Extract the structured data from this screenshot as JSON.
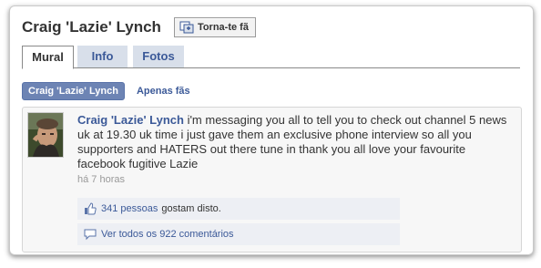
{
  "header": {
    "title": "Craig 'Lazie' Lynch",
    "fan_button": "Torna-te fã"
  },
  "tabs": [
    {
      "label": "Mural",
      "active": true
    },
    {
      "label": "Info",
      "active": false
    },
    {
      "label": "Fotos",
      "active": false
    }
  ],
  "filters": {
    "selected": "Craig 'Lazie' Lynch",
    "other": "Apenas fãs"
  },
  "post": {
    "author": "Craig 'Lazie' Lynch",
    "text": " i'm messaging you all to tell you to check out channel 5 news uk at 19.30 uk time i just gave them an exclusive phone interview so all you supporters and HATERS out there tune in thank you all love your favourite facebook fugitive Lazie",
    "time": "há 7 horas",
    "likes_link": "341 pessoas",
    "likes_suffix": "gostam disto.",
    "comments_link": "Ver todos os 922 comentários"
  },
  "icons": {
    "fan": "fan-page-icon",
    "like": "thumbs-up-icon",
    "comments": "comment-bubble-icon"
  },
  "colors": {
    "link": "#3b5998",
    "pill": "#6d84b4",
    "tab_inactive_bg": "#d8dfea",
    "feedback_bg": "#edeff4"
  }
}
